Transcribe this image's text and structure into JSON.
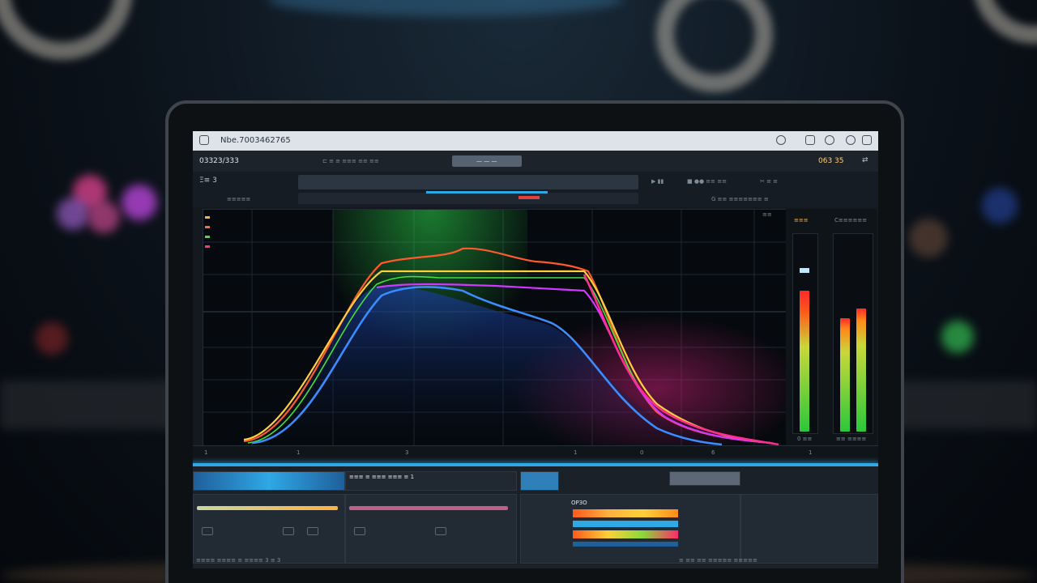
{
  "window": {
    "title": "Nbe.7003462765",
    "toolbar_left_label": "03323/333",
    "toolbar_right_label": "063 35",
    "toolbar_field": "— — —",
    "toolbar2_left_label": "Ξ≡  3",
    "toolbar2_sub_label": "≡≡≡≡≡",
    "toolbar2_right_label": "G ≡≡ ≡≡≡≡≡≡≡ ≡"
  },
  "graph": {
    "top_right_label": "≡≡",
    "x_ticks": [
      "1",
      "1",
      "3",
      "1",
      "0",
      "6"
    ],
    "ruler_right": "1",
    "curve_colors": [
      "#ff6a3a",
      "#ffd23a",
      "#41e03c",
      "#d236ff",
      "#3a8cff",
      "#ff2e8c"
    ]
  },
  "meters": {
    "left_label": "≡≡≡",
    "right_label": "C≡≡≡≡≡≡",
    "left_value": 0.72,
    "right_value": 0.58,
    "bottom_left": "0 ≡≡",
    "bottom_right": "≡≡ ≡≡≡≡"
  },
  "lower": {
    "panel2_label": "≡≡≡ ≡ ≡≡≡ ≡≡≡ ≡ 1",
    "panel4_label": "OP3O",
    "footer_left": "≡≡≡≡ ≡≡≡≡ ≡ ≡≡≡≡ 3 ≡ 3",
    "footer_right": "≡ ≡≡ ≡≡ ≡≡≡≡≡ ≡≡≡≡≡",
    "accent": "#2fa8e6"
  },
  "icons": [
    "app-icon",
    "settings-icon",
    "info-icon",
    "transfer-icon",
    "clock-icon",
    "power-icon",
    "play-icon",
    "stop-icon",
    "scissors-icon"
  ]
}
